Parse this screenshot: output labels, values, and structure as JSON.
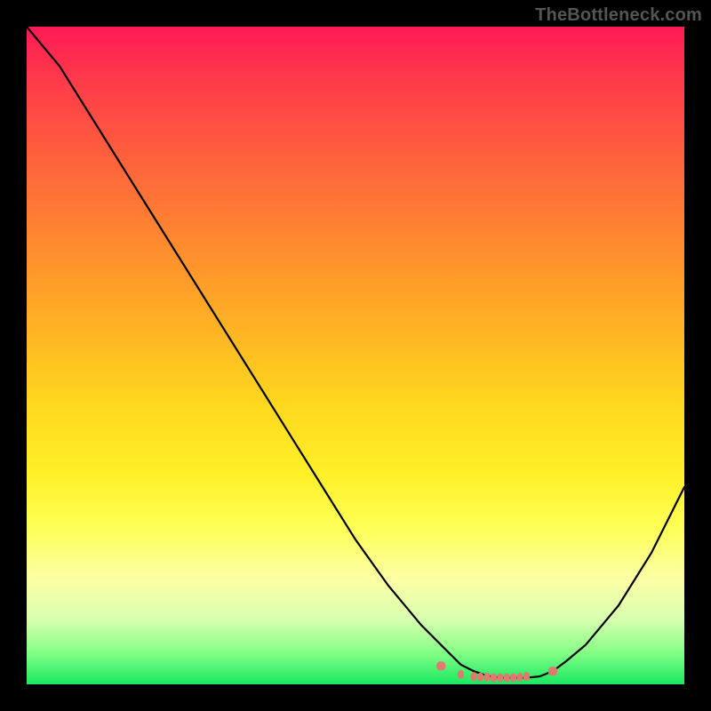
{
  "watermark": "TheBottleneck.com",
  "chart_data": {
    "type": "line",
    "title": "",
    "xlabel": "",
    "ylabel": "",
    "xlim": [
      0,
      100
    ],
    "ylim": [
      0,
      100
    ],
    "x": [
      0,
      5,
      10,
      15,
      20,
      25,
      30,
      35,
      40,
      45,
      50,
      55,
      60,
      65,
      66,
      68,
      70,
      72,
      74,
      76,
      78,
      80,
      82,
      85,
      90,
      95,
      100
    ],
    "y": [
      100,
      94,
      86,
      78,
      70,
      62,
      54,
      46,
      38,
      30,
      22,
      15,
      9,
      4,
      3,
      2,
      1.3,
      1,
      1,
      1,
      1.2,
      2,
      3.5,
      6,
      12,
      20,
      30
    ],
    "bottom_markers_x": [
      63,
      66,
      68,
      69,
      70,
      71,
      72,
      73,
      74,
      75,
      76,
      80
    ],
    "bottom_markers_y": [
      2.8,
      1.5,
      1.2,
      1.1,
      1.1,
      1.0,
      1.0,
      1.0,
      1.0,
      1.1,
      1.2,
      2.0
    ],
    "gradient_colors": {
      "top": "#ff1a55",
      "mid_upper": "#ff9a2a",
      "mid": "#ffff55",
      "mid_lower": "#d9ffb0",
      "bottom": "#18e860"
    }
  }
}
